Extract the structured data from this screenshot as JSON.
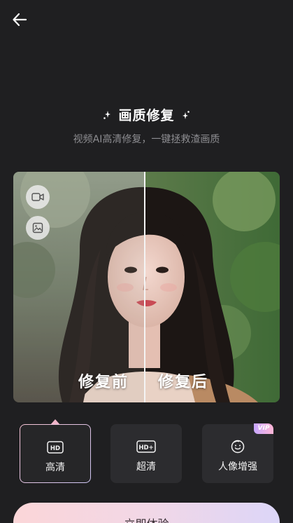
{
  "header": {
    "back_icon": "arrow-left-icon"
  },
  "hero": {
    "title": "画质修复",
    "subtitle": "视频AI高清修复，一键拯救渣画质"
  },
  "compare": {
    "before_label": "修复前",
    "after_label": "修复后",
    "buttons": [
      {
        "icon": "video-camera-icon"
      },
      {
        "icon": "image-icon"
      }
    ]
  },
  "options": [
    {
      "label": "高清",
      "icon": "hd-icon",
      "selected": true
    },
    {
      "label": "超清",
      "icon": "hd-plus-icon",
      "selected": false
    },
    {
      "label": "人像增强",
      "icon": "face-smile-icon",
      "selected": false,
      "badge": "VIP"
    }
  ],
  "cta": {
    "label": "立即体验"
  },
  "colors": {
    "background": "#1f1f21",
    "card": "#2c2c2f",
    "accent_pink": "#f6c3d4",
    "accent_lilac": "#cfc6f5"
  }
}
